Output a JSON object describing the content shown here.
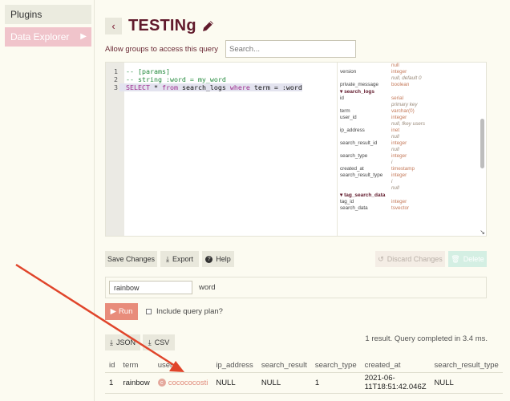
{
  "sidebar": {
    "items": [
      {
        "label": "Plugins",
        "active": false
      },
      {
        "label": "Data Explorer",
        "active": true
      }
    ]
  },
  "header": {
    "title": "TESTINg"
  },
  "access": {
    "label": "Allow groups to access this query",
    "placeholder": "Search..."
  },
  "editor": {
    "lines": [
      {
        "num": "1",
        "text": "-- [params]"
      },
      {
        "num": "2",
        "text": "-- string :word = my_word"
      },
      {
        "num": "3",
        "text": "SELECT * from search_logs where term = :word"
      }
    ],
    "line3_parts": [
      "SELECT",
      " * ",
      "from",
      " search_logs ",
      "where",
      " term = :word"
    ]
  },
  "schema": {
    "top": [
      {
        "field": "",
        "type": "null",
        "note": ""
      },
      {
        "field": "version",
        "type": "integer",
        "note": "null, default 0"
      },
      {
        "field": "private_message",
        "type": "boolean",
        "note": ""
      }
    ],
    "search_logs_title": "search_logs",
    "search_logs": [
      {
        "field": "id",
        "type": "serial",
        "note": "primary key"
      },
      {
        "field": "term",
        "type": "varchar(0)",
        "note": ""
      },
      {
        "field": "user_id",
        "type": "integer",
        "note": "null, fkey users"
      },
      {
        "field": "ip_address",
        "type": "inet",
        "note": "null"
      },
      {
        "field": "search_result_id",
        "type": "integer",
        "note": "null"
      },
      {
        "field": "search_type",
        "type": "integer",
        "note": "i"
      },
      {
        "field": "created_at",
        "type": "timestamp",
        "note": ""
      },
      {
        "field": "search_result_type",
        "type": "integer",
        "note": "i\nnull"
      }
    ],
    "tag_title": "tag_search_data",
    "tag_search_data": [
      {
        "field": "tag_id",
        "type": "integer",
        "note": ""
      },
      {
        "field": "search_data",
        "type": "tsvector",
        "note": ""
      }
    ]
  },
  "toolbar": {
    "save": "Save Changes",
    "export": "Export",
    "help": "Help",
    "discard": "Discard Changes",
    "delete": "Delete"
  },
  "params": {
    "value": "rainbow",
    "label": "word"
  },
  "run": {
    "label": "Run",
    "plan_label": "Include query plan?"
  },
  "downloads": {
    "json": "JSON",
    "csv": "CSV"
  },
  "result": {
    "summary": "1 result. Query completed in 3.4 ms.",
    "columns": [
      "id",
      "term",
      "user",
      "ip_address",
      "search_result",
      "search_type",
      "created_at",
      "search_result_type"
    ],
    "row": {
      "id": "1",
      "term": "rainbow",
      "avatar": "c",
      "user": "cocococosti",
      "ip_address": "NULL",
      "search_result": "NULL",
      "search_type": "1",
      "created_at": "2021-06-11T18:51:42.046Z",
      "search_result_type": "NULL"
    }
  },
  "colors": {
    "accent": "#611a2c",
    "sidebar_active": "#f0c4cb",
    "run_button": "#e88c7b",
    "annotation_arrow": "#e0452b"
  }
}
